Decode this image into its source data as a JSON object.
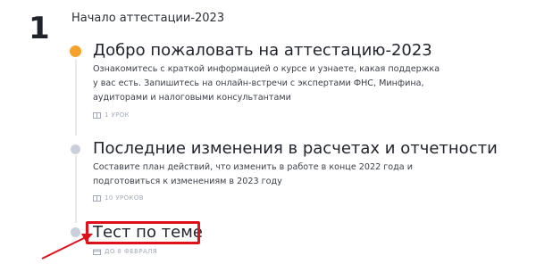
{
  "section": {
    "number": "1",
    "title": "Начало аттестации-2023"
  },
  "lessons": [
    {
      "title": "Добро пожаловать на аттестацию-2023",
      "description": "Ознакомитесь с краткой информацией о курсе и узнаете, какая поддержка у вас есть. Запишитесь на онлайн-встречи с экспертами ФНС, Минфина, аудиторами и налоговыми консультантами",
      "meta": "1 урок",
      "meta_icon": "book-icon",
      "status": "active"
    },
    {
      "title": "Последние изменения в расчетах и отчетности",
      "description": "Составите план действий, что изменить в работе в конце 2022 года и подготовиться к изменениям в 2023 году",
      "meta": "10 уроков",
      "meta_icon": "book-icon",
      "status": "inactive"
    },
    {
      "title": "Тест по теме",
      "description": "",
      "meta": "до 8 февраля",
      "meta_icon": "calendar-icon",
      "status": "inactive"
    }
  ],
  "colors": {
    "active_dot": "#f6a12a",
    "inactive_dot": "#c9cfdb",
    "highlight": "#e0101b"
  }
}
